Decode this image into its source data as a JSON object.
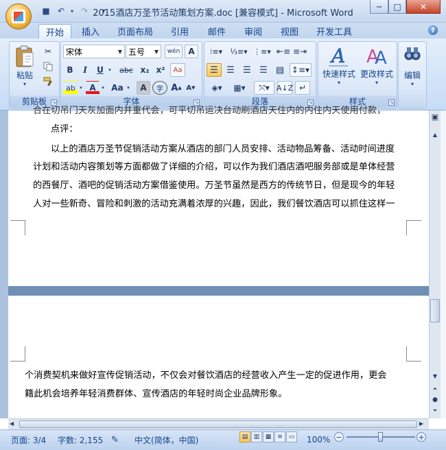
{
  "window": {
    "title": "2015酒店万圣节活动策划方案.doc [兼容模式] - Microsoft Word",
    "minimize": "─",
    "maximize": "□",
    "close": "✕"
  },
  "qat": {
    "save": "■",
    "undo": "↶",
    "redo": "↷",
    "customize": "▾"
  },
  "tabs": [
    {
      "label": "开始"
    },
    {
      "label": "插入"
    },
    {
      "label": "页面布局"
    },
    {
      "label": "引用"
    },
    {
      "label": "邮件"
    },
    {
      "label": "审阅"
    },
    {
      "label": "视图"
    },
    {
      "label": "开发工具"
    }
  ],
  "help": "?",
  "ribbon": {
    "clipboard": {
      "label": "剪贴板",
      "paste": "粘贴"
    },
    "font": {
      "label": "字体",
      "font_name": "宋体",
      "font_size": "五号",
      "wen": "wén",
      "a_box": "A",
      "bold": "B",
      "italic": "I",
      "underline": "U",
      "strike": "abc",
      "sub": "x₂",
      "sup": "x²",
      "clear": "Aa",
      "highlight": "ab",
      "fontcolor": "A",
      "case": "Aa",
      "shade": "A",
      "enclose": "字",
      "grow": "A",
      "shrink": "A"
    },
    "paragraph": {
      "label": "段落"
    },
    "styles": {
      "label": "样式",
      "quick": "快速样式",
      "change": "更改样式"
    },
    "editing": {
      "label": "编辑"
    }
  },
  "document": {
    "page1": {
      "cut_line": "合在切吊门天灰加面内并重代会，可平切吊运决台动刷酒店天住内的内住内天使用付款，",
      "comment_label": "点评：",
      "lines": [
        "以上的酒店万圣节促销活动方案从酒店的部门人员安排、活动物品筹备、活动时间进度",
        "计划和活动内容策划等方面都做了详细的介绍，可以作为我们酒店酒吧服务部或是单体经营",
        "的西餐厅、酒吧的促销活动方案借鉴使用。万圣节虽然是西方的传统节日，但是现今的年轻",
        "人对一些新奇、冒险和刺激的活动充满着浓厚的兴趣，因此，我们餐饮酒店可以抓住这样一"
      ]
    },
    "page2": {
      "lines": [
        "个消费契机来做好宣传促销活动，不仅会对餐饮酒店的经营收入产生一定的促进作用，更会",
        "籍此机会培养年轻消费群体、宣传酒店的年轻时尚企业品牌形象。"
      ]
    }
  },
  "status": {
    "page": "页面: 3/4",
    "words": "字数: 2,155",
    "language": "中文(简体，中国)",
    "zoom": "100%",
    "zoom_out": "−",
    "zoom_in": "+"
  }
}
